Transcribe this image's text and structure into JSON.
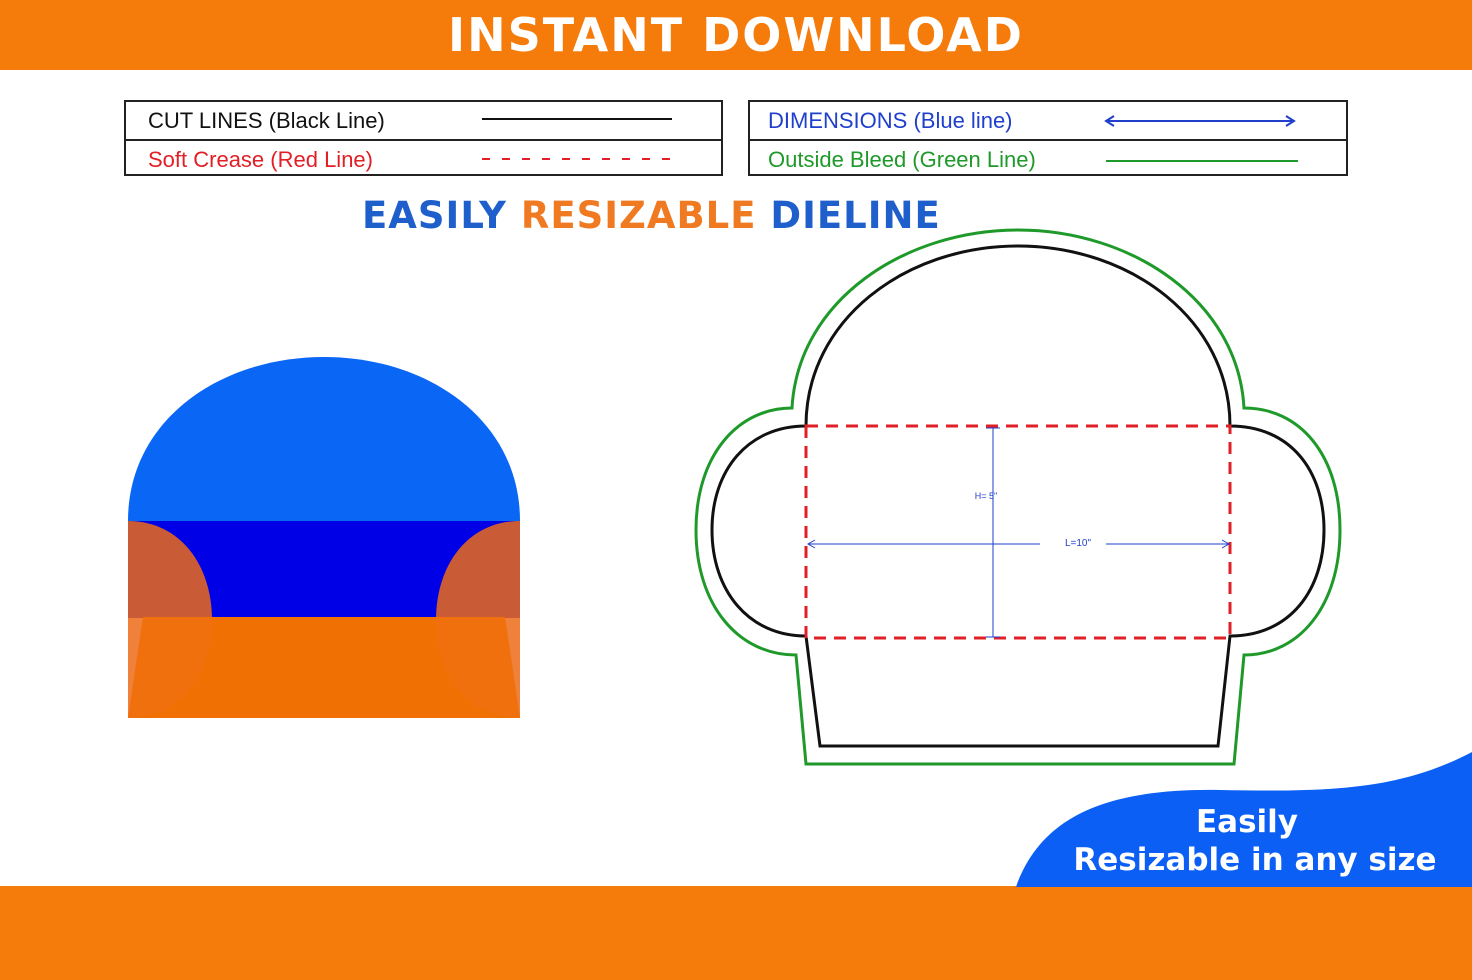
{
  "banner": {
    "title": "INSTANT DOWNLOAD"
  },
  "legend_left": {
    "cut_lines": "CUT LINES (Black Line)",
    "soft_crease": "Soft Crease (Red Line)"
  },
  "legend_right": {
    "dimensions": "DIMENSIONS (Blue line)",
    "outside_bleed": "Outside Bleed (Green Line)"
  },
  "heading": {
    "part1": "EASILY",
    "part2": "RESIZABLE",
    "part3": "DIELINE"
  },
  "dieline": {
    "height_label": "H= 5\"",
    "length_label": "L=10\""
  },
  "promo": {
    "line1": "Easily",
    "line2": "Resizable in any size"
  },
  "colors": {
    "banner_orange": "#f57b0b",
    "heading_blue": "#1f5fcc",
    "heading_orange": "#ef7a22",
    "cut_black": "#111111",
    "crease_red": "#e21f26",
    "dimension_blue": "#1f3fcc",
    "bleed_green": "#1f9a2a",
    "flap_blue": "#0a66f5",
    "panel_navy": "#0000e6",
    "side_orange": "#ec6b18",
    "front_orange": "#f5740a"
  }
}
